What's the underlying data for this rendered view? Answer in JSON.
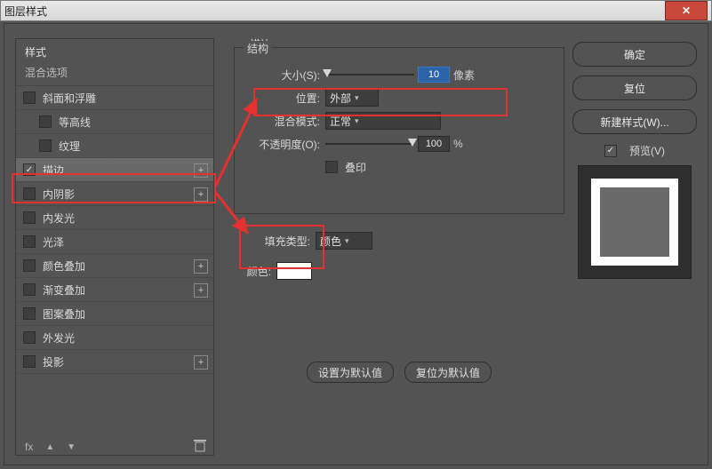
{
  "window": {
    "title": "图层样式"
  },
  "sidebar": {
    "head": "样式",
    "sub": "混合选项",
    "items": [
      {
        "label": "斜面和浮雕",
        "checked": false,
        "indent": false,
        "plus": false
      },
      {
        "label": "等高线",
        "checked": false,
        "indent": true,
        "plus": false
      },
      {
        "label": "纹理",
        "checked": false,
        "indent": true,
        "plus": false
      },
      {
        "label": "描边",
        "checked": true,
        "indent": false,
        "plus": true,
        "selected": true
      },
      {
        "label": "内阴影",
        "checked": false,
        "indent": false,
        "plus": true
      },
      {
        "label": "内发光",
        "checked": false,
        "indent": false,
        "plus": false
      },
      {
        "label": "光泽",
        "checked": false,
        "indent": false,
        "plus": false
      },
      {
        "label": "颜色叠加",
        "checked": false,
        "indent": false,
        "plus": true
      },
      {
        "label": "渐变叠加",
        "checked": false,
        "indent": false,
        "plus": true
      },
      {
        "label": "图案叠加",
        "checked": false,
        "indent": false,
        "plus": false
      },
      {
        "label": "外发光",
        "checked": false,
        "indent": false,
        "plus": false
      },
      {
        "label": "投影",
        "checked": false,
        "indent": false,
        "plus": true
      }
    ],
    "fx": "fx"
  },
  "stroke": {
    "title": "描边",
    "struct_title": "结构",
    "size_label": "大小(S):",
    "size_value": "10",
    "size_unit": "像素",
    "position_label": "位置:",
    "position_value": "外部",
    "blend_label": "混合模式:",
    "blend_value": "正常",
    "opacity_label": "不透明度(O):",
    "opacity_value": "100",
    "opacity_unit": "%",
    "overprint_label": "叠印",
    "fill_label": "填充类型:",
    "fill_value": "颜色",
    "color_label": "颜色:",
    "color_hex": "#ffffff",
    "default_btn": "设置为默认值",
    "reset_btn": "复位为默认值"
  },
  "right": {
    "ok": "确定",
    "reset": "复位",
    "new_style": "新建样式(W)...",
    "preview_label": "预览(V)",
    "preview_checked": true
  }
}
